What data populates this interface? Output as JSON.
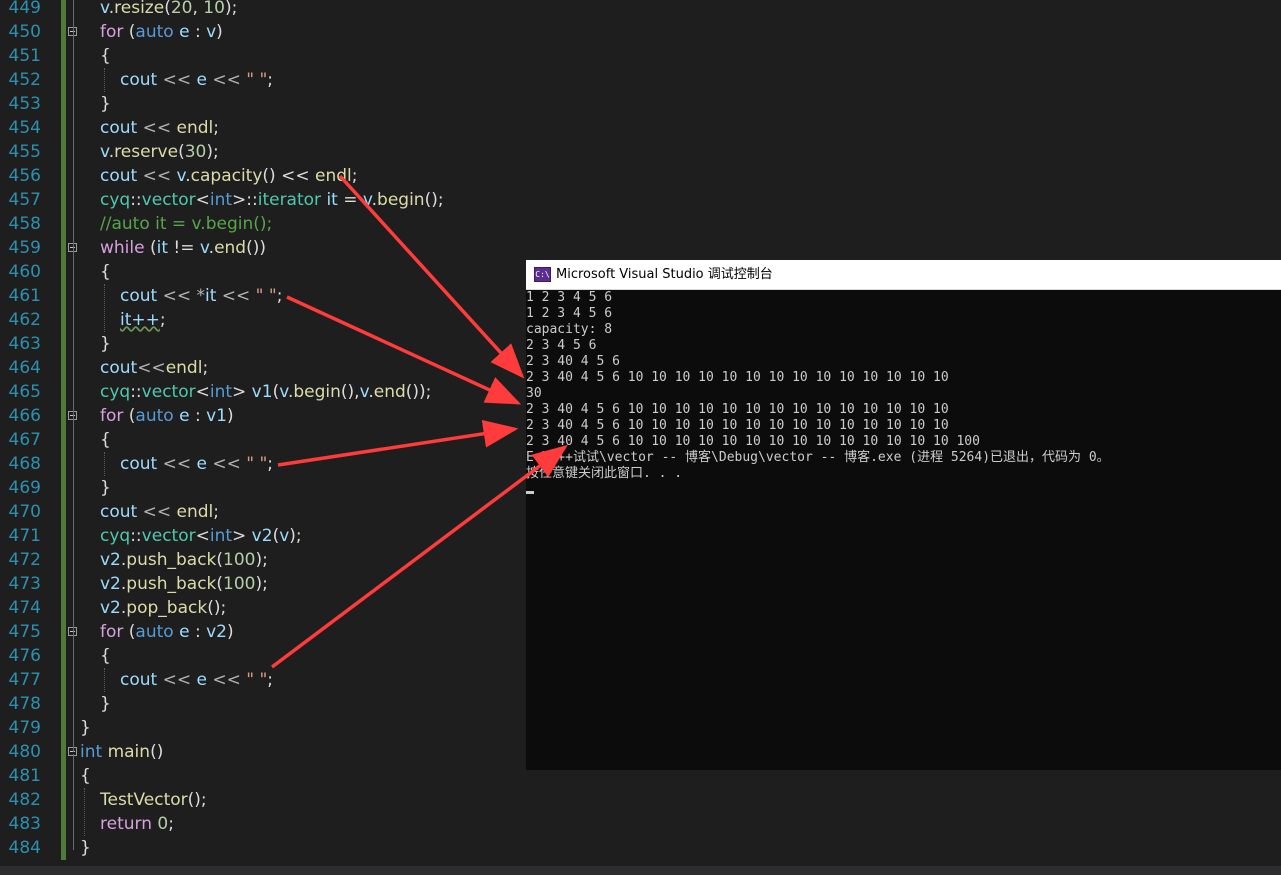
{
  "editor": {
    "lines": [
      {
        "num": "449",
        "fold": false,
        "indent": 1,
        "tokens": [
          [
            "v",
            "var"
          ],
          [
            ".",
            "sym"
          ],
          [
            "resize",
            "fn"
          ],
          [
            "(",
            "sym"
          ],
          [
            "20",
            "num"
          ],
          [
            ", ",
            "sym"
          ],
          [
            "10",
            "num"
          ],
          [
            ");",
            "sym"
          ]
        ]
      },
      {
        "num": "450",
        "fold": true,
        "indent": 1,
        "tokens": [
          [
            "for",
            "ctrl"
          ],
          [
            " (",
            "sym"
          ],
          [
            "auto",
            "kw"
          ],
          [
            " ",
            "sym"
          ],
          [
            "e",
            "var"
          ],
          [
            " : ",
            "sym"
          ],
          [
            "v",
            "var"
          ],
          [
            ")",
            "sym"
          ]
        ]
      },
      {
        "num": "451",
        "fold": false,
        "indent": 1,
        "tokens": [
          [
            "{",
            "sym"
          ]
        ]
      },
      {
        "num": "452",
        "fold": false,
        "indent": 2,
        "tokens": [
          [
            "cout",
            "var"
          ],
          [
            " << ",
            "op"
          ],
          [
            "e",
            "var"
          ],
          [
            " << ",
            "op"
          ],
          [
            "\" \"",
            "str"
          ],
          [
            ";",
            "sym"
          ]
        ]
      },
      {
        "num": "453",
        "fold": false,
        "indent": 1,
        "tokens": [
          [
            "}",
            "sym"
          ]
        ]
      },
      {
        "num": "454",
        "fold": false,
        "indent": 1,
        "tokens": [
          [
            "cout",
            "var"
          ],
          [
            " << ",
            "op"
          ],
          [
            "endl",
            "fn"
          ],
          [
            ";",
            "sym"
          ]
        ]
      },
      {
        "num": "455",
        "fold": false,
        "indent": 1,
        "tokens": [
          [
            "v",
            "var"
          ],
          [
            ".",
            "sym"
          ],
          [
            "reserve",
            "fn"
          ],
          [
            "(",
            "sym"
          ],
          [
            "30",
            "num"
          ],
          [
            ");",
            "sym"
          ]
        ]
      },
      {
        "num": "456",
        "fold": false,
        "indent": 1,
        "tokens": [
          [
            "cout",
            "var"
          ],
          [
            " << ",
            "op"
          ],
          [
            "v",
            "var"
          ],
          [
            ".",
            "sym"
          ],
          [
            "capacity",
            "fn"
          ],
          [
            "() << ",
            "sym"
          ],
          [
            "endl",
            "fn"
          ],
          [
            ";",
            "sym"
          ]
        ]
      },
      {
        "num": "457",
        "fold": false,
        "indent": 1,
        "tokens": [
          [
            "cyq",
            "type"
          ],
          [
            "::",
            "sym"
          ],
          [
            "vector",
            "type"
          ],
          [
            "<",
            "sym"
          ],
          [
            "int",
            "kw"
          ],
          [
            ">::",
            "sym"
          ],
          [
            "iterator",
            "type"
          ],
          [
            " ",
            "sym"
          ],
          [
            "it",
            "var"
          ],
          [
            " = ",
            "sym"
          ],
          [
            "v",
            "var"
          ],
          [
            ".",
            "sym"
          ],
          [
            "begin",
            "fn"
          ],
          [
            "();",
            "sym"
          ]
        ]
      },
      {
        "num": "458",
        "fold": false,
        "indent": 1,
        "tokens": [
          [
            "//auto it = v.begin();",
            "cmt"
          ]
        ]
      },
      {
        "num": "459",
        "fold": true,
        "indent": 1,
        "tokens": [
          [
            "while",
            "ctrl"
          ],
          [
            " (",
            "sym"
          ],
          [
            "it",
            "var"
          ],
          [
            " != ",
            "sym"
          ],
          [
            "v",
            "var"
          ],
          [
            ".",
            "sym"
          ],
          [
            "end",
            "fn"
          ],
          [
            "())",
            "sym"
          ]
        ]
      },
      {
        "num": "460",
        "fold": false,
        "indent": 1,
        "tokens": [
          [
            "{",
            "sym"
          ]
        ]
      },
      {
        "num": "461",
        "fold": false,
        "indent": 2,
        "tokens": [
          [
            "cout",
            "var"
          ],
          [
            " << *",
            "op"
          ],
          [
            "it",
            "var"
          ],
          [
            " << ",
            "op"
          ],
          [
            "\" \"",
            "str"
          ],
          [
            ";",
            "sym"
          ]
        ]
      },
      {
        "num": "462",
        "fold": false,
        "indent": 2,
        "tokens": [
          [
            "it++",
            "squig"
          ],
          [
            ";",
            "sym"
          ]
        ]
      },
      {
        "num": "463",
        "fold": false,
        "indent": 1,
        "tokens": [
          [
            "}",
            "sym"
          ]
        ]
      },
      {
        "num": "464",
        "fold": false,
        "indent": 1,
        "tokens": [
          [
            "cout",
            "var"
          ],
          [
            "<<",
            "op"
          ],
          [
            "endl",
            "fn"
          ],
          [
            ";",
            "sym"
          ]
        ]
      },
      {
        "num": "465",
        "fold": false,
        "indent": 1,
        "tokens": [
          [
            "cyq",
            "type"
          ],
          [
            "::",
            "sym"
          ],
          [
            "vector",
            "type"
          ],
          [
            "<",
            "sym"
          ],
          [
            "int",
            "kw"
          ],
          [
            "> ",
            "sym"
          ],
          [
            "v1",
            "var"
          ],
          [
            "(",
            "sym"
          ],
          [
            "v",
            "var"
          ],
          [
            ".",
            "sym"
          ],
          [
            "begin",
            "fn"
          ],
          [
            "(),",
            "sym"
          ],
          [
            "v",
            "var"
          ],
          [
            ".",
            "sym"
          ],
          [
            "end",
            "fn"
          ],
          [
            "());",
            "sym"
          ]
        ]
      },
      {
        "num": "466",
        "fold": true,
        "indent": 1,
        "tokens": [
          [
            "for",
            "ctrl"
          ],
          [
            " (",
            "sym"
          ],
          [
            "auto",
            "kw"
          ],
          [
            " ",
            "sym"
          ],
          [
            "e",
            "var"
          ],
          [
            " : ",
            "sym"
          ],
          [
            "v1",
            "var"
          ],
          [
            ")",
            "sym"
          ]
        ]
      },
      {
        "num": "467",
        "fold": false,
        "indent": 1,
        "tokens": [
          [
            "{",
            "sym"
          ]
        ]
      },
      {
        "num": "468",
        "fold": false,
        "indent": 2,
        "tokens": [
          [
            "cout",
            "var"
          ],
          [
            " << ",
            "op"
          ],
          [
            "e",
            "var"
          ],
          [
            " << ",
            "op"
          ],
          [
            "\" \"",
            "str"
          ],
          [
            ";",
            "sym"
          ]
        ]
      },
      {
        "num": "469",
        "fold": false,
        "indent": 1,
        "tokens": [
          [
            "}",
            "sym"
          ]
        ]
      },
      {
        "num": "470",
        "fold": false,
        "indent": 1,
        "tokens": [
          [
            "cout",
            "var"
          ],
          [
            " << ",
            "op"
          ],
          [
            "endl",
            "fn"
          ],
          [
            ";",
            "sym"
          ]
        ]
      },
      {
        "num": "471",
        "fold": false,
        "indent": 1,
        "tokens": [
          [
            "cyq",
            "type"
          ],
          [
            "::",
            "sym"
          ],
          [
            "vector",
            "type"
          ],
          [
            "<",
            "sym"
          ],
          [
            "int",
            "kw"
          ],
          [
            "> ",
            "sym"
          ],
          [
            "v2",
            "var"
          ],
          [
            "(",
            "sym"
          ],
          [
            "v",
            "var"
          ],
          [
            ");",
            "sym"
          ]
        ]
      },
      {
        "num": "472",
        "fold": false,
        "indent": 1,
        "tokens": [
          [
            "v2",
            "var"
          ],
          [
            ".",
            "sym"
          ],
          [
            "push_back",
            "fn"
          ],
          [
            "(",
            "sym"
          ],
          [
            "100",
            "num"
          ],
          [
            ");",
            "sym"
          ]
        ]
      },
      {
        "num": "473",
        "fold": false,
        "indent": 1,
        "tokens": [
          [
            "v2",
            "var"
          ],
          [
            ".",
            "sym"
          ],
          [
            "push_back",
            "fn"
          ],
          [
            "(",
            "sym"
          ],
          [
            "100",
            "num"
          ],
          [
            ");",
            "sym"
          ]
        ]
      },
      {
        "num": "474",
        "fold": false,
        "indent": 1,
        "tokens": [
          [
            "v2",
            "var"
          ],
          [
            ".",
            "sym"
          ],
          [
            "pop_back",
            "fn"
          ],
          [
            "();",
            "sym"
          ]
        ]
      },
      {
        "num": "475",
        "fold": true,
        "indent": 1,
        "tokens": [
          [
            "for",
            "ctrl"
          ],
          [
            " (",
            "sym"
          ],
          [
            "auto",
            "kw"
          ],
          [
            " ",
            "sym"
          ],
          [
            "e",
            "var"
          ],
          [
            " : ",
            "sym"
          ],
          [
            "v2",
            "var"
          ],
          [
            ")",
            "sym"
          ]
        ]
      },
      {
        "num": "476",
        "fold": false,
        "indent": 1,
        "tokens": [
          [
            "{",
            "sym"
          ]
        ]
      },
      {
        "num": "477",
        "fold": false,
        "indent": 2,
        "tokens": [
          [
            "cout",
            "var"
          ],
          [
            " << ",
            "op"
          ],
          [
            "e",
            "var"
          ],
          [
            " << ",
            "op"
          ],
          [
            "\" \"",
            "str"
          ],
          [
            ";",
            "sym"
          ]
        ]
      },
      {
        "num": "478",
        "fold": false,
        "indent": 1,
        "tokens": [
          [
            "}",
            "sym"
          ]
        ]
      },
      {
        "num": "479",
        "fold": false,
        "indent": 0,
        "tokens": [
          [
            "}",
            "sym"
          ]
        ]
      },
      {
        "num": "480",
        "fold": true,
        "indent": 0,
        "tokens": [
          [
            "int",
            "kw"
          ],
          [
            " ",
            "sym"
          ],
          [
            "main",
            "fn"
          ],
          [
            "()",
            "sym"
          ]
        ]
      },
      {
        "num": "481",
        "fold": false,
        "indent": 0,
        "tokens": [
          [
            "{",
            "sym"
          ]
        ]
      },
      {
        "num": "482",
        "fold": false,
        "indent": 1,
        "tokens": [
          [
            "TestVector",
            "fn"
          ],
          [
            "();",
            "sym"
          ]
        ]
      },
      {
        "num": "483",
        "fold": false,
        "indent": 1,
        "tokens": [
          [
            "return",
            "ctrl"
          ],
          [
            " ",
            "sym"
          ],
          [
            "0",
            "num"
          ],
          [
            ";",
            "sym"
          ]
        ]
      },
      {
        "num": "484",
        "fold": false,
        "indent": 0,
        "tokens": [
          [
            "}",
            "sym"
          ]
        ]
      }
    ]
  },
  "console": {
    "icon_text": "C:\\",
    "title": "Microsoft Visual Studio 调试控制台",
    "lines": [
      "1 2 3 4 5 6",
      "1 2 3 4 5 6",
      "capacity: 8",
      "2 3 4 5 6",
      "2 3 40 4 5 6",
      "2 3 40 4 5 6 10 10 10 10 10 10 10 10 10 10 10 10 10 10",
      "30",
      "2 3 40 4 5 6 10 10 10 10 10 10 10 10 10 10 10 10 10 10",
      "2 3 40 4 5 6 10 10 10 10 10 10 10 10 10 10 10 10 10 10",
      "2 3 40 4 5 6 10 10 10 10 10 10 10 10 10 10 10 10 10 10 100",
      "E:\\C++试试\\vector -- 博客\\Debug\\vector -- 博客.exe (进程 5264)已退出，代码为 0。",
      "按任意键关闭此窗口. . ."
    ]
  },
  "colors": {
    "background": "#1e1e1e",
    "line_number": "#2b91af",
    "keyword": "#569cd6",
    "control": "#d8a0df",
    "type": "#4ec9b0",
    "variable": "#9cdcfe",
    "function": "#dcdcaa",
    "number": "#b5cea8",
    "string": "#d69d85",
    "comment": "#57a64a",
    "arrow": "#ff3b3b"
  }
}
